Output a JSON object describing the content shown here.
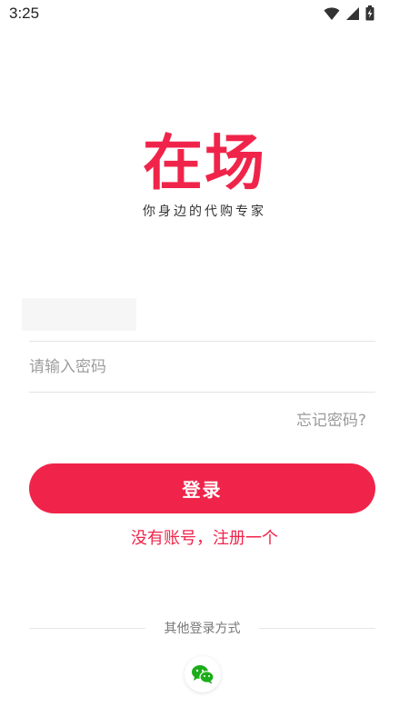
{
  "status_bar": {
    "time": "3:25",
    "icons": [
      "wifi-icon",
      "cell-signal-icon",
      "battery-icon"
    ]
  },
  "logo": {
    "text": "在场",
    "slogan": "你身边的代购专家",
    "color": "#f0244a"
  },
  "form": {
    "account_value": "",
    "password_placeholder": "请输入密码",
    "forgot_label": "忘记密码?",
    "login_label": "登录",
    "register_label": "没有账号，注册一个"
  },
  "other_login": {
    "label": "其他登录方式",
    "options": [
      {
        "icon": "wechat-icon"
      }
    ]
  },
  "colors": {
    "accent": "#f0244a",
    "wechat": "#1aad19"
  }
}
